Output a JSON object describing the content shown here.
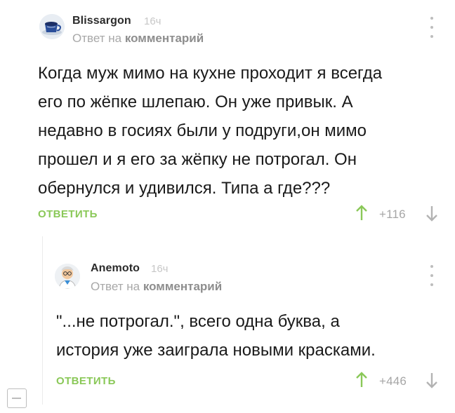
{
  "comments": [
    {
      "author": "Blissargon",
      "time": "16ч",
      "reply_prefix": "Ответ на",
      "reply_target": "комментарий",
      "text_lines": [
        "Когда муж мимо на кухне проходит я всегда",
        "его по жёпке шлепаю. Он уже привык. А",
        "недавно в госиях были у подруги,он мимо",
        "прошел и я его за жёпку не потрогал. Он",
        "обернулся и удивился. Типа а где???"
      ],
      "reply_label": "ОТВЕТИТЬ",
      "rating": "+116",
      "avatar_icon": "coffee-cup-avatar"
    },
    {
      "author": "Anemoto",
      "time": "16ч",
      "reply_prefix": "Ответ на",
      "reply_target": "комментарий",
      "text_lines": [
        "\"...не потрогал.\", всего одна буква, а",
        "история уже заиграла новыми красками."
      ],
      "reply_label": "ОТВЕТИТЬ",
      "rating": "+446",
      "avatar_icon": "cartoon-professor-avatar"
    }
  ],
  "colors": {
    "accent_green": "#8ac858",
    "muted_gray": "#a8a8a8"
  }
}
